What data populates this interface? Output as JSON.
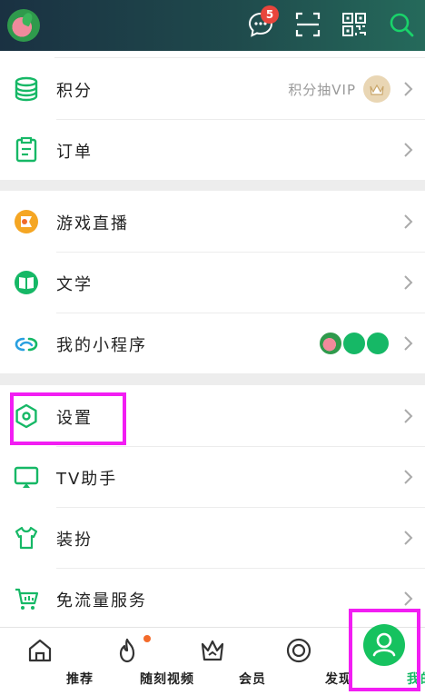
{
  "header": {
    "message_badge_count": "5",
    "icons": [
      "avatar",
      "chat-icon",
      "scan-icon",
      "qrcode-icon",
      "search-icon"
    ]
  },
  "sections": [
    {
      "items": [
        {
          "label": "积分",
          "icon": "database-icon",
          "right_text": "积分抽VIP",
          "right_icon": "crown-badge-icon"
        },
        {
          "label": "订单",
          "icon": "clipboard-icon"
        }
      ]
    },
    {
      "items": [
        {
          "label": "游戏直播",
          "icon": "game-live-icon"
        },
        {
          "label": "文学",
          "icon": "book-icon"
        },
        {
          "label": "我的小程序",
          "icon": "link-icon",
          "mini_apps": [
            "melon-app-icon",
            "book-app-icon",
            "video-app-icon"
          ]
        }
      ]
    },
    {
      "items": [
        {
          "label": "设置",
          "icon": "hexagon-settings-icon"
        },
        {
          "label": "TV助手",
          "icon": "tv-icon"
        },
        {
          "label": "装扮",
          "icon": "tshirt-icon"
        },
        {
          "label": "免流量服务",
          "icon": "cart-icon"
        }
      ]
    }
  ],
  "bottom_nav": [
    {
      "label": "推荐",
      "icon": "home-icon"
    },
    {
      "label": "随刻视频",
      "icon": "flame-icon",
      "has_dot": true
    },
    {
      "label": "会员",
      "icon": "crown-icon"
    },
    {
      "label": "发现",
      "icon": "discover-icon"
    },
    {
      "label": "我的",
      "icon": "person-icon",
      "active": true
    }
  ],
  "colors": {
    "accent": "#16c25f",
    "highlight": "#f21df3",
    "badge": "#e8453c"
  }
}
